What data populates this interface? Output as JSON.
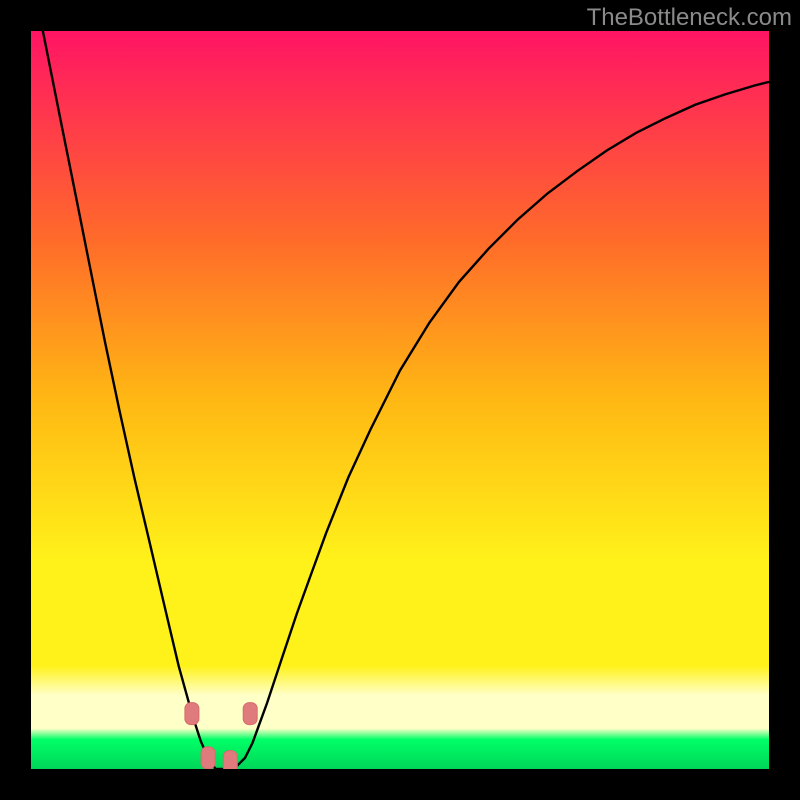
{
  "watermark": "TheBottleneck.com",
  "colors": {
    "frame": "#000000",
    "grad_top": "#ff1464",
    "grad_mid_upper": "#ff6a2a",
    "grad_mid": "#ffb813",
    "grad_mid_lower": "#fff21a",
    "grad_pale": "#ffffc8",
    "grad_green": "#00ff66",
    "grad_bottom": "#00d659",
    "curve": "#000000",
    "marker_stroke": "#d86a6c",
    "marker_fill": "#e07b7d"
  },
  "chart_data": {
    "type": "line",
    "title": "",
    "xlabel": "",
    "ylabel": "",
    "xlim": [
      0,
      1
    ],
    "ylim": [
      0,
      1
    ],
    "x": [
      0.0,
      0.02,
      0.04,
      0.06,
      0.08,
      0.1,
      0.12,
      0.14,
      0.16,
      0.18,
      0.2,
      0.218,
      0.23,
      0.24,
      0.25,
      0.26,
      0.27,
      0.28,
      0.29,
      0.3,
      0.32,
      0.34,
      0.36,
      0.38,
      0.4,
      0.43,
      0.46,
      0.5,
      0.54,
      0.58,
      0.62,
      0.66,
      0.7,
      0.74,
      0.78,
      0.82,
      0.86,
      0.9,
      0.94,
      0.98,
      1.0
    ],
    "y": [
      1.08,
      0.98,
      0.88,
      0.78,
      0.68,
      0.58,
      0.485,
      0.395,
      0.31,
      0.225,
      0.14,
      0.075,
      0.038,
      0.015,
      0.0,
      0.0,
      0.0,
      0.005,
      0.015,
      0.035,
      0.09,
      0.15,
      0.21,
      0.265,
      0.32,
      0.395,
      0.46,
      0.54,
      0.605,
      0.66,
      0.705,
      0.745,
      0.78,
      0.81,
      0.838,
      0.862,
      0.882,
      0.9,
      0.914,
      0.926,
      0.931
    ],
    "markers": [
      {
        "x": 0.218,
        "y": 0.075
      },
      {
        "x": 0.24,
        "y": 0.015
      },
      {
        "x": 0.27,
        "y": 0.01
      },
      {
        "x": 0.297,
        "y": 0.075
      }
    ]
  }
}
